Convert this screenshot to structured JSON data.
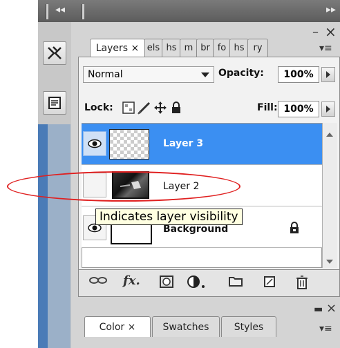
{
  "layers_panel": {
    "tabs": [
      {
        "label": "Layers",
        "close": "×"
      },
      {
        "label": "els"
      },
      {
        "label": "hs"
      },
      {
        "label": "m"
      },
      {
        "label": "br"
      },
      {
        "label": "fo"
      },
      {
        "label": "hs"
      },
      {
        "label": "ry"
      }
    ],
    "blend_mode": "Normal",
    "opacity_label": "Opacity:",
    "opacity_value": "100%",
    "lock_label": "Lock:",
    "fill_label": "Fill:",
    "fill_value": "100%",
    "layers": [
      {
        "name": "Layer 3",
        "visible": true,
        "selected": true
      },
      {
        "name": "Layer 2",
        "visible": false,
        "selected": false
      },
      {
        "name": "Background",
        "visible": true,
        "selected": false,
        "locked": true
      }
    ],
    "tooltip": "Indicates layer visibility"
  },
  "color_panel": {
    "tabs": [
      {
        "label": "Color",
        "close": "×"
      },
      {
        "label": "Swatches"
      },
      {
        "label": "Styles"
      }
    ]
  },
  "top_bar": {
    "collapse_glyph": "◂◂",
    "expand_glyph": "▸▸"
  },
  "panel_controls": {
    "minimize": "–",
    "close": "×",
    "menu": "▾≡"
  },
  "colors": {
    "selection_blue": "#3b8ff2",
    "tooltip_bg": "#ffffe1",
    "annotation_red": "#e02020"
  }
}
